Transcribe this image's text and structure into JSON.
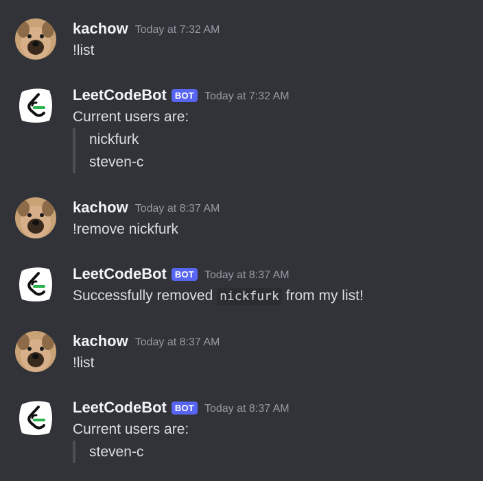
{
  "messages": [
    {
      "author": "kachow",
      "timestamp": "Today at 7:32 AM",
      "text": "!list"
    },
    {
      "author": "LeetCodeBot",
      "bot_tag": "BOT",
      "timestamp": "Today at 7:32 AM",
      "text": "Current users are:",
      "quote_lines": [
        "nickfurk",
        "steven-c"
      ]
    },
    {
      "author": "kachow",
      "timestamp": "Today at 8:37 AM",
      "text": "!remove nickfurk"
    },
    {
      "author": "LeetCodeBot",
      "bot_tag": "BOT",
      "timestamp": "Today at 8:37 AM",
      "text_before": "Successfully removed",
      "code": "nickfurk",
      "text_after": "from my list!"
    },
    {
      "author": "kachow",
      "timestamp": "Today at 8:37 AM",
      "text": "!list"
    },
    {
      "author": "LeetCodeBot",
      "bot_tag": "BOT",
      "timestamp": "Today at 8:37 AM",
      "text": "Current users are:",
      "quote_lines": [
        "steven-c"
      ]
    }
  ],
  "colors": {
    "background": "#313338",
    "bot_tag": "#5865f2",
    "timestamp": "#949ba4",
    "quote_bar": "#4e5058"
  },
  "avatars": {
    "user": "dog-avatar",
    "bot": "leetcode-logo-avatar"
  }
}
